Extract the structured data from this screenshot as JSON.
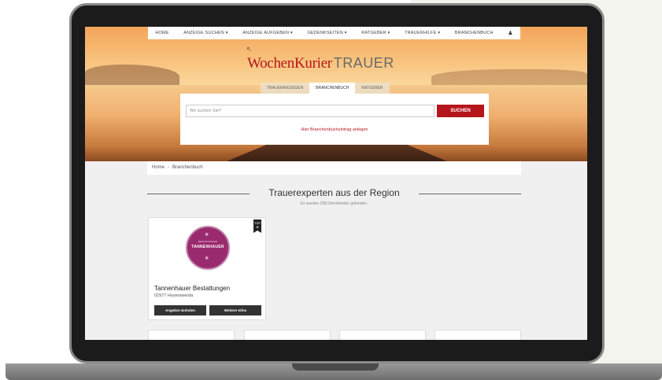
{
  "nav": {
    "items": [
      "HOME",
      "ANZEIGE SUCHEN ▾",
      "ANZEIGE AUFGEBEN ▾",
      "GEDENKSEITEN ▾",
      "RATGEBER ▾",
      "TRAUERHILFE ▾",
      "BRANCHENBUCH"
    ]
  },
  "logo": {
    "brand": "WochenKurier",
    "suffix": "TRAUER"
  },
  "search": {
    "tabs": [
      "TRAUERANZEIGEN",
      "BRANCHENBUCH",
      "RATGEBER"
    ],
    "placeholder": "Wo suchen Sie?",
    "button_label": "SUCHEN",
    "entry_link": "Hier Branchenbucheintrag anlegen"
  },
  "breadcrumb": {
    "home": "Home",
    "sep": "›",
    "current": "Branchenbuch"
  },
  "section": {
    "title": "Trauerexperten aus der Region",
    "subtitle": "Es wurden 238 Dienstleister gefunden."
  },
  "card": {
    "badge": "TOP",
    "logo_small": "BESTATTUNGEN",
    "logo_text": "TANNENHAUER",
    "title": "Tannenhauer Bestattungen",
    "location": "02977 Hoyerswerda",
    "button_offer": "Angebot einholen",
    "button_info": "Weitere Infos"
  },
  "colors": {
    "accent": "#b5161c",
    "dark": "#333333",
    "logo_purple": "#9a2a6e"
  }
}
